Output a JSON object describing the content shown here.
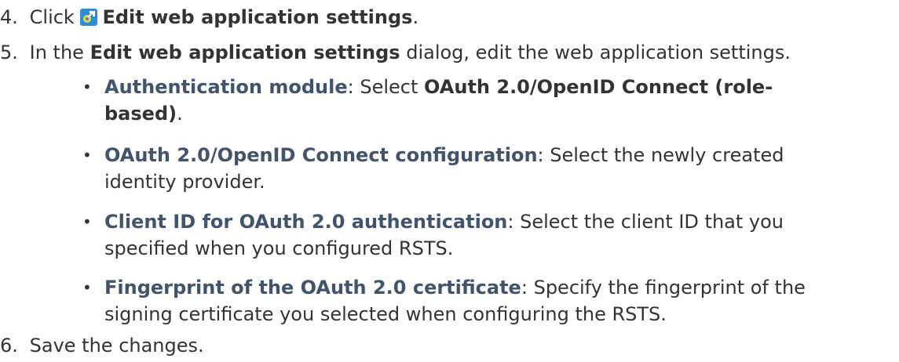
{
  "steps": [
    {
      "number": "4.",
      "prefix": "Click",
      "icon": "edit-settings-icon",
      "action": "Edit web application settings",
      "suffix": "."
    },
    {
      "number": "5.",
      "prefix": "In the",
      "dialog_name": "Edit web application settings",
      "suffix": "dialog, edit the web application settings."
    },
    {
      "number": "6.",
      "text": "Save the changes."
    }
  ],
  "settings": [
    {
      "label": "Authentication module",
      "sep": ":",
      "text_before": "Select",
      "value_line1": "OAuth 2.0/OpenID Connect (role-",
      "value_line2": "based)",
      "text_after": "."
    },
    {
      "label": "OAuth 2.0/OpenID Connect configuration",
      "sep": ":",
      "line1_rest": "Select the newly created",
      "line2": "identity provider."
    },
    {
      "label": "Client ID for OAuth 2.0 authentication",
      "sep": ":",
      "line1_rest": "Select the client ID that you",
      "line2": "specified when you configured RSTS."
    },
    {
      "label": "Fingerprint of the OAuth 2.0 certificate",
      "sep": ":",
      "line1_rest": "Specify the fingerprint of the",
      "line2": "signing certificate you selected when configuring the RSTS."
    }
  ],
  "colors": {
    "text": "#333333",
    "ui_term": "#41546b",
    "icon_bg": "#2a8fd6",
    "icon_gear": "#f4d03f"
  }
}
